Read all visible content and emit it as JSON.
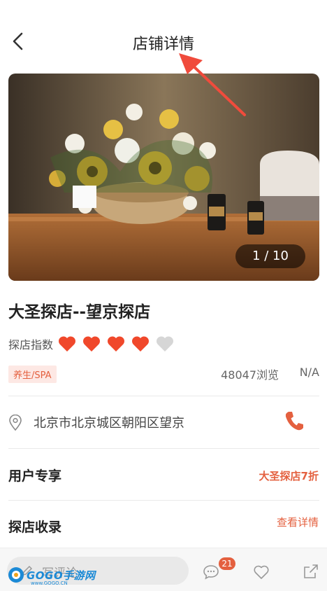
{
  "header": {
    "title": "店铺详情",
    "back_icon": "chevron-left-icon"
  },
  "gallery": {
    "counter": "1 / 10"
  },
  "store": {
    "name": "大圣探店--望京探店",
    "rating_label": "探店指数",
    "rating_value": 4,
    "rating_max": 5,
    "category_tag": "养生/SPA",
    "views": "48047浏览",
    "price": "N/A",
    "address": "北京市北京城区朝阳区望京"
  },
  "sections": {
    "user_exclusive": {
      "title": "用户专享",
      "link": "大圣探店7折"
    },
    "records": {
      "title": "探店收录",
      "link": "查看详情"
    }
  },
  "bottom_bar": {
    "comment_placeholder": "写评论",
    "comment_count": "21"
  },
  "watermark": {
    "text": "GOGO手游网",
    "url": "www.GOGO.CN"
  },
  "colors": {
    "accent": "#e4603f",
    "heart_active": "#f0482b",
    "heart_inactive": "#d6d6d6"
  }
}
